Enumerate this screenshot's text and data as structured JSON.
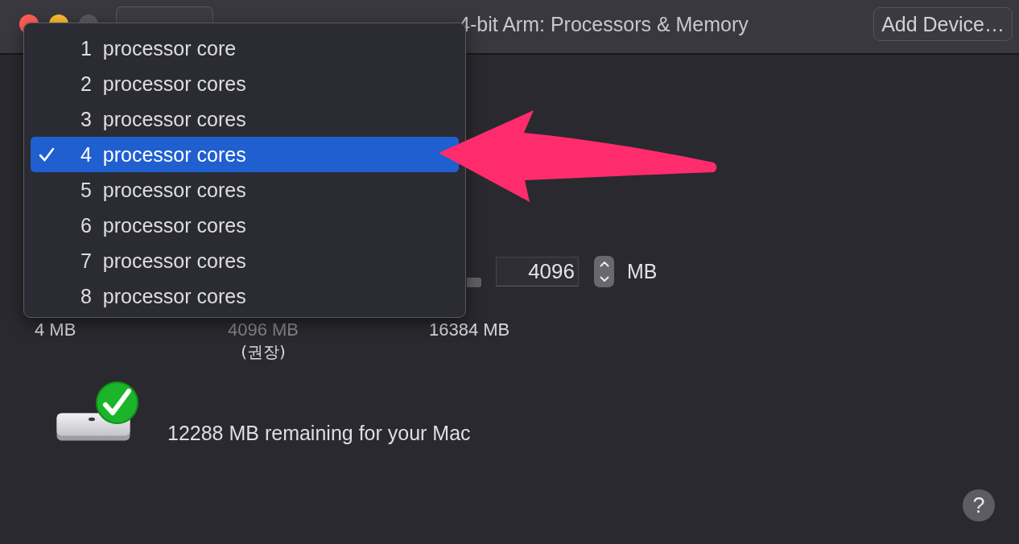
{
  "window": {
    "title": "4-bit Arm: Processors & Memory",
    "buttons": [
      {
        "kind": "close",
        "disabled": false
      },
      {
        "kind": "minimize",
        "disabled": false
      },
      {
        "kind": "zoom",
        "disabled": true
      }
    ]
  },
  "toolbar": {
    "add_device_button": "Add Device…"
  },
  "processor_menu": {
    "items": [
      {
        "label": "1  processor core",
        "selected": false
      },
      {
        "label": "2  processor cores",
        "selected": false
      },
      {
        "label": "3  processor cores",
        "selected": false
      },
      {
        "label": "4  processor cores",
        "selected": true
      },
      {
        "label": "5  processor cores",
        "selected": false
      },
      {
        "label": "6  processor cores",
        "selected": false
      },
      {
        "label": "7  processor cores",
        "selected": false
      },
      {
        "label": "8  processor cores",
        "selected": false
      }
    ]
  },
  "memory": {
    "value": "4096",
    "unit": "MB",
    "scale_labels": [
      {
        "text": "4 MB",
        "dimmed": false
      },
      {
        "text": "4096 MB",
        "dimmed": true,
        "note": "(권장)"
      },
      {
        "text": "16384 MB",
        "dimmed": false
      }
    ]
  },
  "status": {
    "ok": true,
    "text": "12288 MB remaining for your Mac"
  },
  "help_button": {
    "label": "?"
  }
}
